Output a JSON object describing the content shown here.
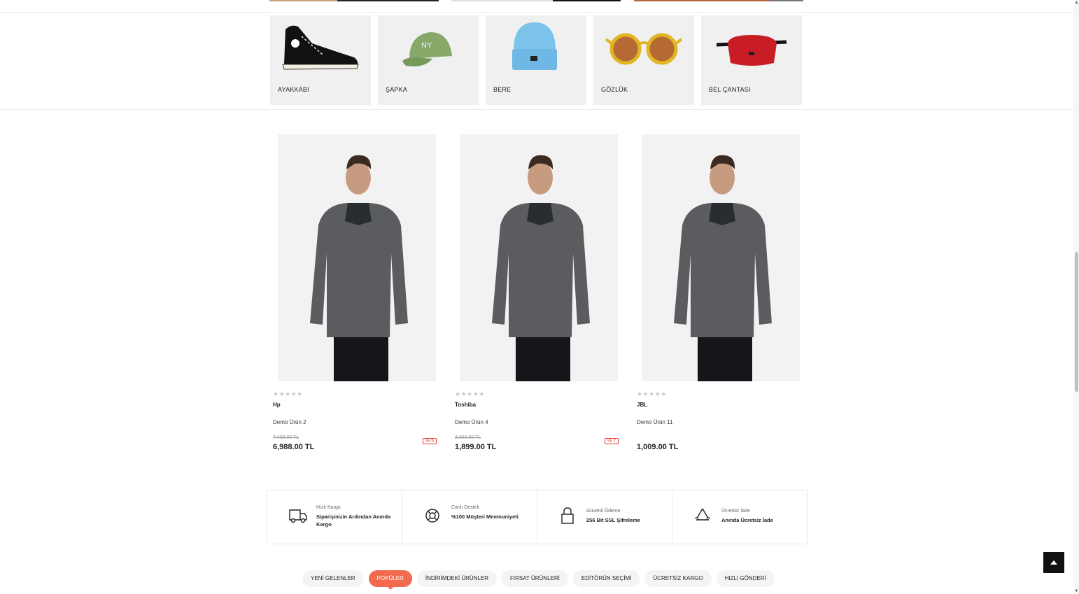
{
  "categories": [
    {
      "label": "AYAKKABI",
      "icon": "sneaker"
    },
    {
      "label": "ŞAPKA",
      "icon": "cap"
    },
    {
      "label": "BERE",
      "icon": "beanie"
    },
    {
      "label": "GÖZLÜK",
      "icon": "sunglasses"
    },
    {
      "label": "BEL ÇANTASI",
      "icon": "waist-bag"
    }
  ],
  "products": [
    {
      "stars": "★★★★★",
      "brand": "Hp",
      "name": "Demo Ürün 2",
      "old_price": "7,400.00 TL",
      "price": "6,988.00 TL",
      "discount": "% 5"
    },
    {
      "stars": "★★★★★",
      "brand": "Toshiba",
      "name": "Demo Ürün 4",
      "old_price": "2,050.00 TL",
      "price": "1,899.00 TL",
      "discount": "% 7"
    },
    {
      "stars": "★★★★★",
      "brand": "JBL",
      "name": "Demo Ürün 11",
      "old_price": "",
      "price": "1,009.00 TL",
      "discount": ""
    }
  ],
  "features": [
    {
      "title": "Hızlı Kargo",
      "text": "Siparişinizin Ardından Anında Kargo",
      "icon": "truck-icon"
    },
    {
      "title": "Canlı Destek",
      "text": "%100 Müşteri Memnuniyeti",
      "icon": "lifebuoy-icon"
    },
    {
      "title": "Güvenli Ödeme",
      "text": "256 Bit SSL Şifreleme",
      "icon": "lock-icon"
    },
    {
      "title": "Ücretsiz İade",
      "text": "Anında Ücretsiz İade",
      "icon": "recycle-icon"
    }
  ],
  "tabs": [
    "YENİ GELENLER",
    "POPÜLER",
    "İNDİRİMDEKİ ÜRÜNLER",
    "FIRSAT ÜRÜNLERİ",
    "EDİTÖRÜN SEÇİMİ",
    "ÜCRETSİZ KARGO",
    "HIZLI GÖNDERİ"
  ],
  "active_tab": "POPÜLER",
  "colors": {
    "accent": "#f26b4f",
    "discount": "#e53935"
  }
}
